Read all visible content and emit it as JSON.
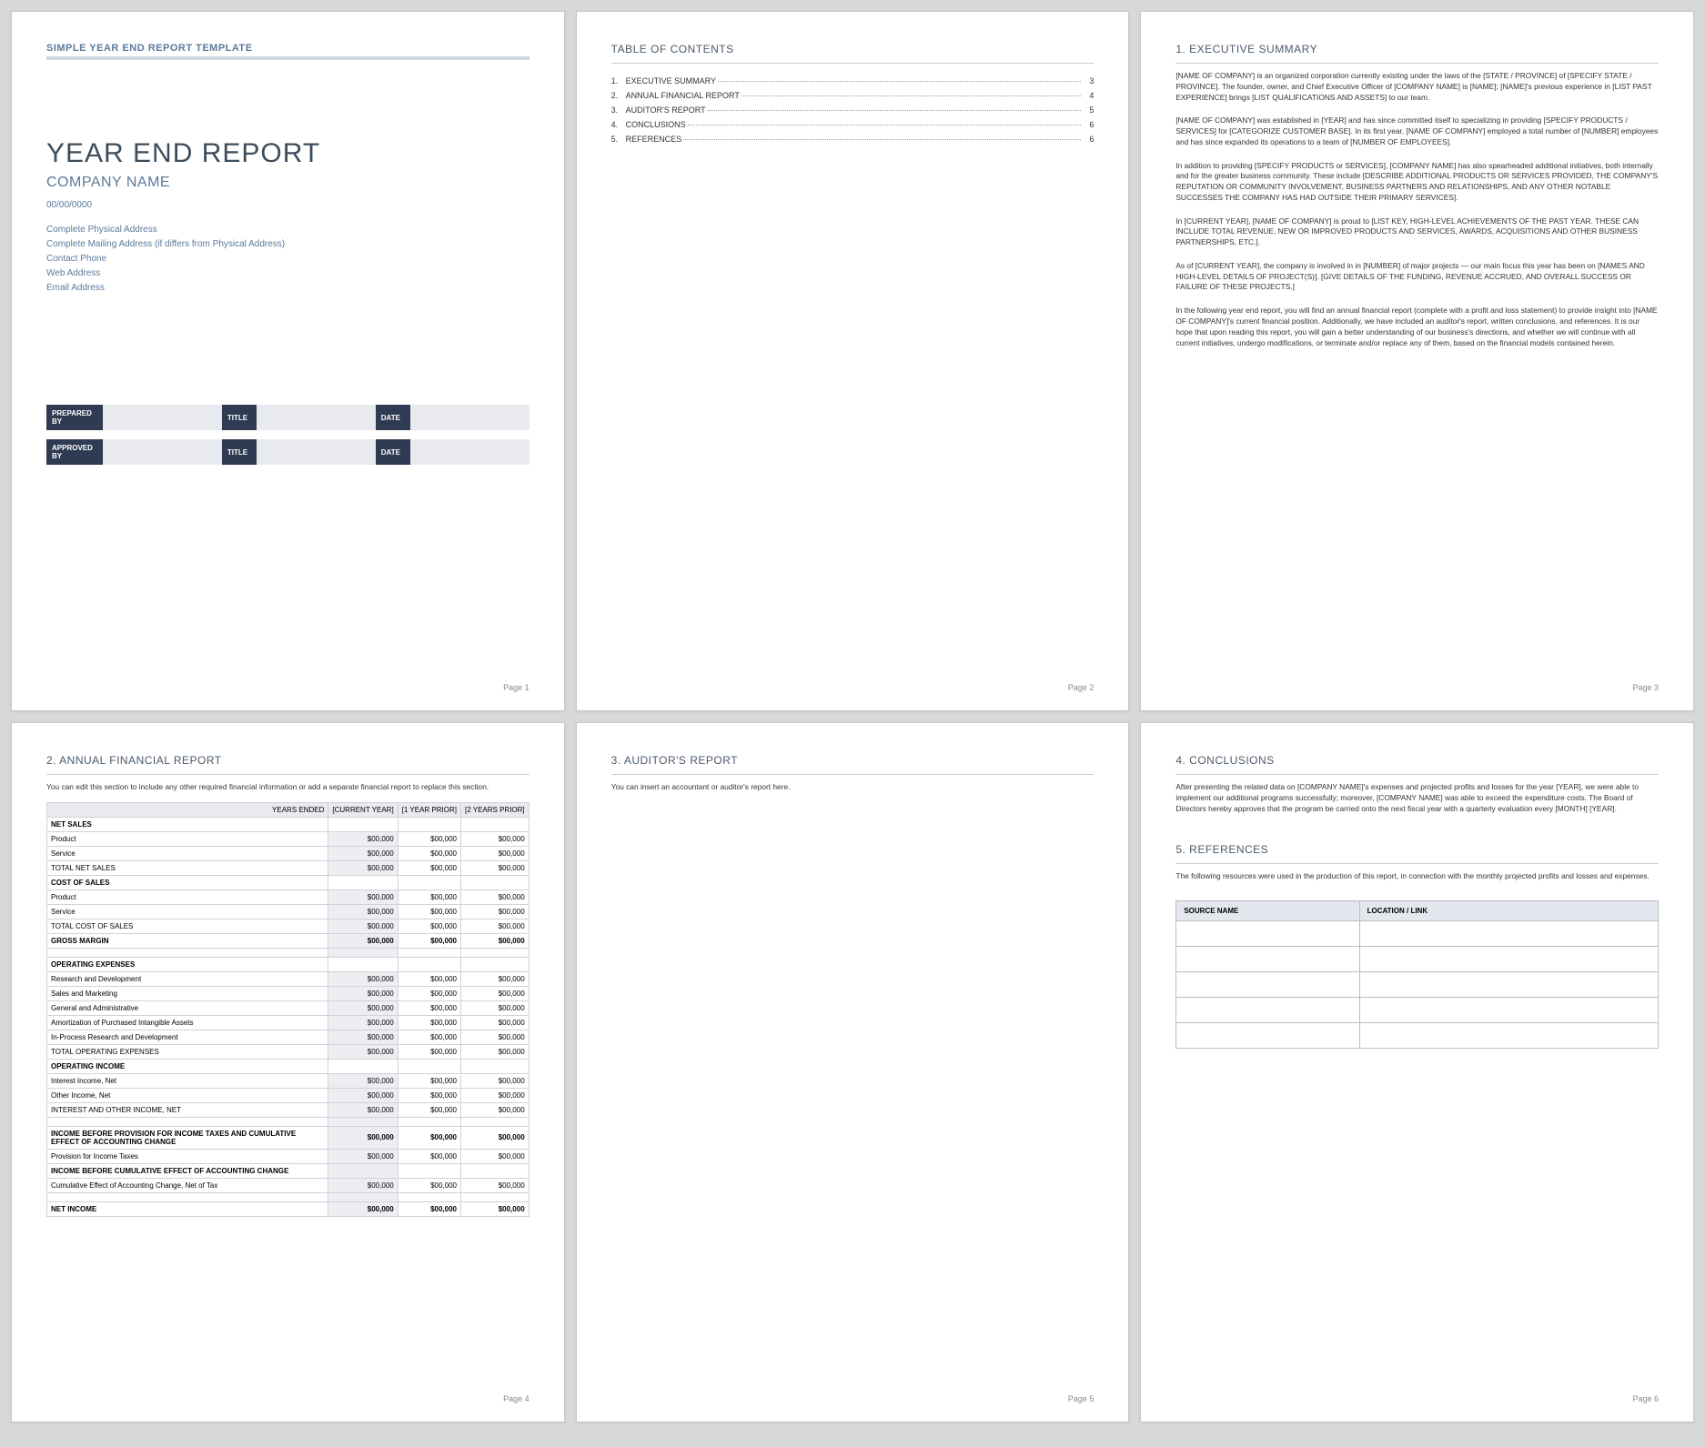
{
  "template_label": "SIMPLE YEAR END REPORT TEMPLATE",
  "cover": {
    "title": "YEAR END REPORT",
    "company": "COMPANY NAME",
    "date": "00/00/0000",
    "addr1": "Complete Physical Address",
    "addr2": "Complete Mailing Address (if differs from Physical Address)",
    "phone": "Contact Phone",
    "web": "Web Address",
    "email": "Email Address",
    "sig": {
      "prepared": "PREPARED BY",
      "approved": "APPROVED BY",
      "title": "TITLE",
      "date": "DATE"
    }
  },
  "toc": {
    "heading": "TABLE OF CONTENTS",
    "items": [
      {
        "n": "1.",
        "label": "EXECUTIVE SUMMARY",
        "page": "3"
      },
      {
        "n": "2.",
        "label": "ANNUAL FINANCIAL REPORT",
        "page": "4"
      },
      {
        "n": "3.",
        "label": "AUDITOR'S REPORT",
        "page": "5"
      },
      {
        "n": "4.",
        "label": "CONCLUSIONS",
        "page": "6"
      },
      {
        "n": "5.",
        "label": "REFERENCES",
        "page": "6"
      }
    ]
  },
  "exec": {
    "heading": "1. EXECUTIVE SUMMARY",
    "p1": "[NAME OF COMPANY] is an organized corporation currently existing under the laws of the [STATE / PROVINCE] of [SPECIFY STATE / PROVINCE]. The founder, owner, and Chief Executive Officer of [COMPANY NAME] is [NAME]; [NAME]'s previous experience in [LIST PAST EXPERIENCE] brings [LIST QUALIFICATIONS AND ASSETS] to our team.",
    "p2": "[NAME OF COMPANY] was established in [YEAR] and has since committed itself to specializing in providing [SPECIFY PRODUCTS / SERVICES] for [CATEGORIZE CUSTOMER BASE]. In its first year, [NAME OF COMPANY] employed a total number of [NUMBER] employees and has since expanded its operations to a team of [NUMBER OF EMPLOYEES].",
    "p3": "In addition to providing [SPECIFY PRODUCTS or SERVICES], [COMPANY NAME] has also spearheaded additional initiatives, both internally and for the greater business community. These include [DESCRIBE ADDITIONAL PRODUCTS OR SERVICES PROVIDED, THE COMPANY'S REPUTATION OR COMMUNITY INVOLVEMENT, BUSINESS PARTNERS AND RELATIONSHIPS, AND ANY OTHER NOTABLE SUCCESSES THE COMPANY HAS HAD OUTSIDE THEIR PRIMARY SERVICES].",
    "p4": "In [CURRENT YEAR], [NAME OF COMPANY] is proud to [LIST KEY, HIGH-LEVEL ACHIEVEMENTS OF THE PAST YEAR. THESE CAN INCLUDE TOTAL REVENUE, NEW OR IMPROVED PRODUCTS AND SERVICES, AWARDS, ACQUISITIONS AND OTHER BUSINESS PARTNERSHIPS, ETC.].",
    "p5": "As of [CURRENT YEAR], the company is involved in in [NUMBER] of major projects — our main focus this year has been on [NAMES AND HIGH-LEVEL DETAILS OF PROJECT(S)]. [GIVE DETAILS OF THE FUNDING, REVENUE ACCRUED, AND OVERALL SUCCESS OR FAILURE OF THESE PROJECTS.]",
    "p6": "In the following year end report, you will find an annual financial report (complete with a profit and loss statement) to provide insight into [NAME OF COMPANY]'s current financial position. Additionally, we have included an auditor's report, written conclusions, and references. It is our hope that upon reading this report, you will gain a better understanding of our business's directions, and whether we will continue with all current initiatives, undergo modifications, or terminate and/or replace any of them, based on the financial models contained herein."
  },
  "fin": {
    "heading": "2. ANNUAL FINANCIAL REPORT",
    "note": "You can edit this section to include any other required financial information or add a separate financial report to replace this section.",
    "years_label": "YEARS ENDED",
    "cols": [
      "[CURRENT YEAR]",
      "[1 YEAR PRIOR]",
      "[2 YEARS PRIOR]"
    ],
    "val": "$00,000",
    "rows": {
      "net_sales": "NET SALES",
      "product": "Product",
      "service": "Service",
      "total_net_sales": "TOTAL NET SALES",
      "cost_of_sales": "COST OF SALES",
      "total_cost_of_sales": "TOTAL COST OF SALES",
      "gross_margin": "GROSS MARGIN",
      "operating_expenses": "OPERATING EXPENSES",
      "rnd": "Research and Development",
      "sales_mkt": "Sales and Marketing",
      "ga": "General and Administrative",
      "amort": "Amortization of Purchased Intangible Assets",
      "inproc": "In-Process Research and Development",
      "total_opex": "TOTAL OPERATING EXPENSES",
      "operating_income": "OPERATING INCOME",
      "interest_income": "Interest Income, Net",
      "other_income": "Other Income, Net",
      "interest_other": "INTEREST AND OTHER INCOME, NET",
      "inc_before_tax_cum": "INCOME BEFORE PROVISION FOR INCOME TAXES AND CUMULATIVE EFFECT OF ACCOUNTING CHANGE",
      "provision_tax": "Provision for Income Taxes",
      "inc_before_cum": "INCOME BEFORE CUMULATIVE EFFECT OF ACCOUNTING CHANGE",
      "cum_effect": "Cumulative Effect of Accounting Change, Net of Tax",
      "net_income": "NET INCOME"
    }
  },
  "auditor": {
    "heading": "3. AUDITOR'S REPORT",
    "note": "You can insert an accountant or auditor's report here."
  },
  "concl": {
    "heading": "4. CONCLUSIONS",
    "p1": "After presenting the related data on [COMPANY NAME]'s expenses and projected profits and losses for the year [YEAR], we were able to implement our additional programs successfully; moreover, [COMPANY NAME] was able to exceed the expenditure costs. The Board of Directors hereby approves that the program be carried onto the next fiscal year with a quarterly evaluation every [MONTH] [YEAR]."
  },
  "refs": {
    "heading": "5. REFERENCES",
    "note": "The following resources were used in the production of this report, in connection with the monthly projected profits and losses and expenses.",
    "col1": "SOURCE NAME",
    "col2": "LOCATION / LINK"
  },
  "page_labels": [
    "Page 1",
    "Page 2",
    "Page 3",
    "Page 4",
    "Page 5",
    "Page 6"
  ]
}
